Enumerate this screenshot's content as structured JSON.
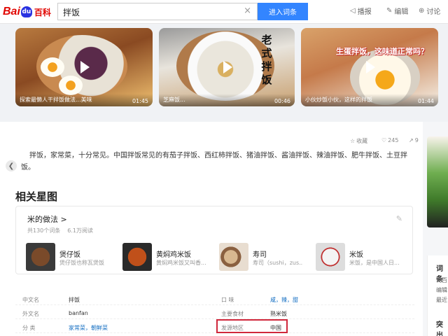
{
  "header": {
    "logo_text": "Bai",
    "logo_paw": "du",
    "logo_suffix": "百科",
    "search_value": "拌饭",
    "clear_glyph": "×",
    "enter_button": "进入词条",
    "tools": [
      {
        "icon": "sound-icon",
        "glyph": "◁",
        "label": "播报"
      },
      {
        "icon": "edit-icon",
        "glyph": "✎",
        "label": "编辑"
      },
      {
        "icon": "gear-icon",
        "glyph": "⊕",
        "label": "讨论"
      }
    ]
  },
  "videos": [
    {
      "caption": "探索最懒人干拌饭做法...美味",
      "duration": "01:45"
    },
    {
      "caption": "芝麻饭...",
      "duration": "00:46",
      "overlay": "老式拌饭"
    },
    {
      "caption": "小伙炒饭小伙，这样的拌饭",
      "duration": "01:44",
      "overlay": "生蛋拌饭，这味道正常吗？"
    }
  ],
  "actions": [
    {
      "icon": "star-icon",
      "glyph": "☆",
      "label": "收藏"
    },
    {
      "icon": "like-icon",
      "glyph": "♡",
      "label": "245"
    },
    {
      "icon": "share-icon",
      "glyph": "↗",
      "label": "9"
    }
  ],
  "summary": "拌饭，家常菜，十分常见。中国拌饭常见的有茄子拌饭、西红柿拌饭、猪油拌饭、酱油拌饭、辣油拌饭、肥牛拌饭、土豆拌饭。",
  "side_arrow": "❮",
  "related": {
    "title": "相关星图",
    "box_title": "米的做法",
    "box_chevron": ">",
    "meta_count": "共130个词条",
    "meta_views": "6.1万阅读",
    "edit_glyph": "✎",
    "dishes": [
      {
        "name": "煲仔饭",
        "desc": "煲仔饭也称瓦煲饭",
        "color": "#7a4a2a"
      },
      {
        "name": "黄焖鸡米饭",
        "desc": "黄焖鸡米饭又叫香...",
        "color": "#c0501a"
      },
      {
        "name": "寿司",
        "desc": "寿司（sushi，zus...",
        "color": "#d8b890"
      },
      {
        "name": "米饭",
        "desc": "米饭，是中国人日...",
        "color": "#f4f4f4"
      }
    ]
  },
  "info": {
    "rows": [
      {
        "k1": "中文名",
        "v1": "拌饭",
        "k2": "口  味",
        "v2": "咸，辣，甜"
      },
      {
        "k1": "外文名",
        "v1": "banfan",
        "k2": "主要食材",
        "v2": "熟米饭"
      },
      {
        "k1": "分  类",
        "v1": "家常菜，朝鲜菜",
        "k2": "发源地区",
        "v2": "中国"
      }
    ]
  },
  "right_panel": {
    "title1": "词条",
    "lines": [
      "词百",
      "编辑",
      "最近"
    ],
    "title2": "突出"
  },
  "colors": {
    "accent": "#3385ff",
    "logo_red": "#e10602",
    "highlight": "#d0283c",
    "link": "#136ec2"
  }
}
